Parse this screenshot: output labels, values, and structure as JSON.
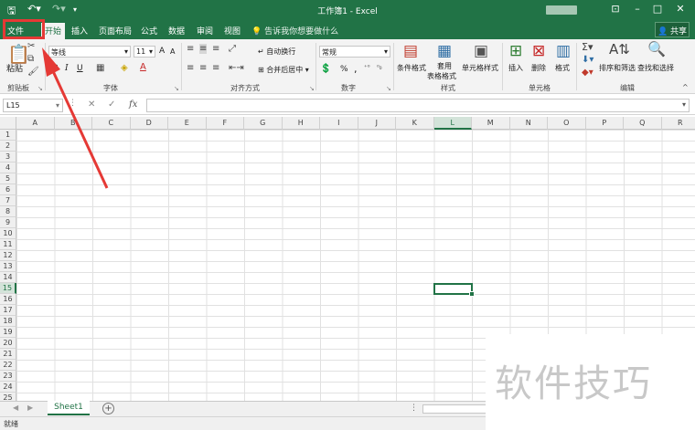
{
  "title_bar": {
    "title": "工作簿1 - Excel",
    "save_icon": "save-icon",
    "undo_icon": "undo-icon",
    "redo_icon": "redo-icon",
    "customize_icon": "customize-icon",
    "window_buttons": [
      "ribbon-display-icon",
      "minimize-icon",
      "restore-icon",
      "close-icon"
    ]
  },
  "ribbon_tabs": [
    "文件",
    "开始",
    "插入",
    "页面布局",
    "公式",
    "数据",
    "审阅",
    "视图"
  ],
  "tell_me": "告诉我你想要做什么",
  "share": "共享",
  "ribbon": {
    "clipboard": {
      "paste": "粘贴",
      "label": "剪贴板"
    },
    "font": {
      "name": "等线",
      "size": "11",
      "bold": "B",
      "italic": "I",
      "underline": "U",
      "grow": "A",
      "shrink": "A",
      "label": "字体"
    },
    "alignment": {
      "wrap": "自动换行",
      "merge": "合并后居中",
      "label": "对齐方式"
    },
    "number": {
      "format": "常规",
      "percent": "%",
      "comma": ",",
      "label": "数字"
    },
    "styles": {
      "conditional": "条件格式",
      "table_line1": "套用",
      "table_line2": "表格格式",
      "cell_styles": "单元格样式",
      "label": "样式"
    },
    "cells": {
      "insert": "插入",
      "delete": "删除",
      "format": "格式",
      "label": "单元格"
    },
    "editing": {
      "sort": "排序和筛选",
      "find": "查找和选择",
      "label": "编辑"
    }
  },
  "formula_bar": {
    "name_box": "L15",
    "cancel": "✕",
    "enter": "✓",
    "fx": "fx",
    "value": ""
  },
  "columns": [
    "A",
    "B",
    "C",
    "D",
    "E",
    "F",
    "G",
    "H",
    "I",
    "J",
    "K",
    "L",
    "M",
    "N",
    "O",
    "P",
    "Q",
    "R"
  ],
  "rows": [
    "1",
    "2",
    "3",
    "4",
    "5",
    "6",
    "7",
    "8",
    "9",
    "10",
    "11",
    "12",
    "13",
    "14",
    "15",
    "16",
    "17",
    "18",
    "19",
    "20",
    "21",
    "22",
    "23",
    "24",
    "25",
    "26"
  ],
  "active_cell": {
    "column": "L",
    "row": "15"
  },
  "sheet_tabs": [
    "Sheet1"
  ],
  "status": "就绪",
  "watermark": "软件技巧",
  "colors": {
    "excel_green": "#217346",
    "highlight_red": "#e53935"
  }
}
